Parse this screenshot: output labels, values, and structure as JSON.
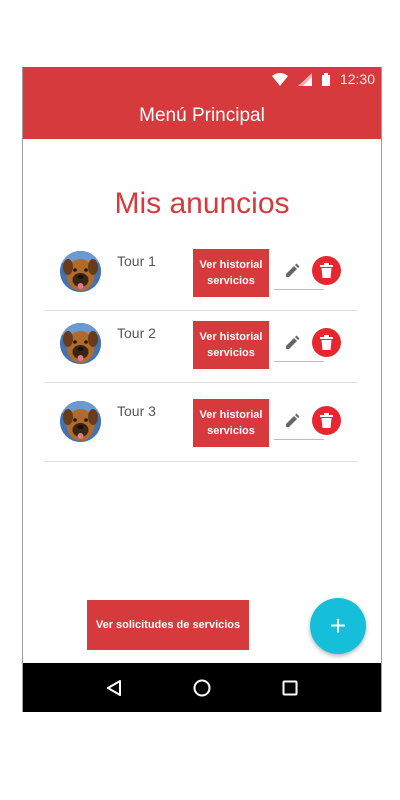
{
  "status_bar": {
    "time": "12:30"
  },
  "app_bar": {
    "title": "Menú Principal"
  },
  "page": {
    "heading": "Mis anuncios"
  },
  "ads": [
    {
      "title": "Tour 1",
      "history_label": "Ver historial servicios"
    },
    {
      "title": "Tour 2",
      "history_label": "Ver historial servicios"
    },
    {
      "title": "Tour 3",
      "history_label": "Ver historial servicios"
    }
  ],
  "footer": {
    "requests_label": "Ver solicitudes de servicios",
    "fab_icon": "plus-icon",
    "fab_glyph": "+"
  },
  "colors": {
    "primary": "#d63a3c",
    "delete": "#e8262e",
    "fab": "#15bfd9",
    "nav": "#000000"
  }
}
